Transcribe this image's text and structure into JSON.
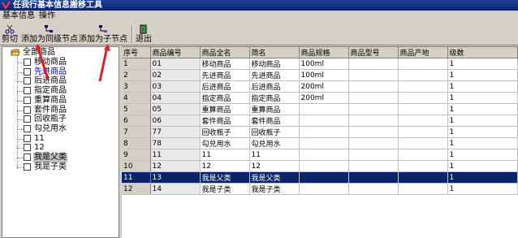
{
  "app": {
    "title": "任我行基本信息搬移工具"
  },
  "menu": [
    {
      "label": "基本信息"
    },
    {
      "label": "操作"
    }
  ],
  "toolbar": {
    "cut": "剪切",
    "add_sibling": "添加为同级节点",
    "add_child": "添加为子节点",
    "exit": "退出"
  },
  "tree": {
    "root": "全部商品",
    "items": [
      {
        "label": "移动商品"
      },
      {
        "label": "先进商品"
      },
      {
        "label": "后进商品"
      },
      {
        "label": "指定商品"
      },
      {
        "label": "重算商品"
      },
      {
        "label": "套件商品"
      },
      {
        "label": "回收瓶子"
      },
      {
        "label": "勾兑用水"
      },
      {
        "label": "11"
      },
      {
        "label": "12"
      },
      {
        "label": "我是父类"
      },
      {
        "label": "我是子类"
      }
    ],
    "selected_index": 10
  },
  "grid": {
    "columns": [
      "序号",
      "商品编号",
      "商品全名",
      "简名",
      "商品规格",
      "商品型号",
      "商品产地",
      "级数"
    ],
    "rows": [
      [
        "1",
        "01",
        "移动商品",
        "移动商品",
        "100ml",
        "",
        "",
        "1"
      ],
      [
        "2",
        "02",
        "先进商品",
        "先进商品",
        "100ml",
        "",
        "",
        "1"
      ],
      [
        "3",
        "03",
        "后进商品",
        "后进商品",
        "200ml",
        "",
        "",
        "1"
      ],
      [
        "4",
        "04",
        "指定商品",
        "指定商品",
        "200ml",
        "",
        "",
        "1"
      ],
      [
        "5",
        "05",
        "重算商品",
        "重算商品",
        "",
        "",
        "",
        "1"
      ],
      [
        "6",
        "06",
        "套件商品",
        "套件商品",
        "",
        "",
        "",
        "1"
      ],
      [
        "7",
        "77",
        "回收瓶子",
        "回收瓶子",
        "",
        "",
        "",
        "1"
      ],
      [
        "8",
        "78",
        "勾兑用水",
        "勾兑用水",
        "",
        "",
        "",
        "1"
      ],
      [
        "9",
        "11",
        "11",
        "11",
        "",
        "",
        "",
        "1"
      ],
      [
        "10",
        "12",
        "12",
        "12",
        "",
        "",
        "",
        "1"
      ],
      [
        "11",
        "13",
        "我是父类",
        "我是父类",
        "",
        "",
        "",
        "1"
      ],
      [
        "12",
        "14",
        "我是子类",
        "我是子类",
        "",
        "",
        "",
        "1"
      ]
    ],
    "selected_row": 10
  }
}
